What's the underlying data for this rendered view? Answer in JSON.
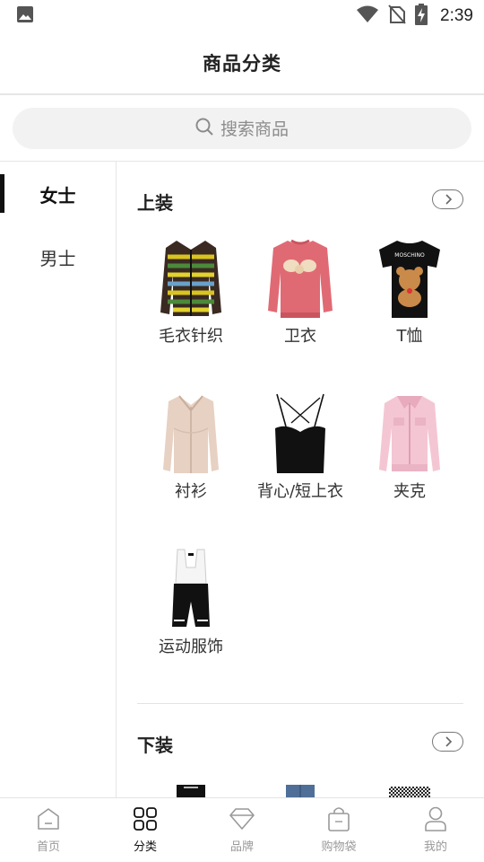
{
  "status_bar": {
    "time": "2:39"
  },
  "header": {
    "title": "商品分类"
  },
  "search": {
    "placeholder": "搜索商品"
  },
  "sidebar": {
    "items": [
      {
        "label": "女士",
        "active": true
      },
      {
        "label": "男士",
        "active": false
      }
    ]
  },
  "sections": [
    {
      "title": "上装",
      "items": [
        {
          "label": "毛衣针织",
          "icon": "cardigan-image"
        },
        {
          "label": "卫衣",
          "icon": "sweatshirt-image"
        },
        {
          "label": "T恤",
          "icon": "tshirt-image"
        },
        {
          "label": "衬衫",
          "icon": "shirt-image"
        },
        {
          "label": "背心/短上衣",
          "icon": "camisole-image"
        },
        {
          "label": "夹克",
          "icon": "jacket-image"
        },
        {
          "label": "运动服饰",
          "icon": "cycling-suit-image"
        }
      ]
    },
    {
      "title": "下装",
      "items": [
        {
          "label": "",
          "icon": "skirt-image"
        },
        {
          "label": "",
          "icon": "jeans-image"
        },
        {
          "label": "",
          "icon": "tweed-skirt-image"
        }
      ]
    }
  ],
  "bottom_nav": {
    "items": [
      {
        "label": "首页",
        "icon": "home-icon",
        "active": false
      },
      {
        "label": "分类",
        "icon": "category-icon",
        "active": true
      },
      {
        "label": "品牌",
        "icon": "diamond-icon",
        "active": false
      },
      {
        "label": "购物袋",
        "icon": "shopping-bag-icon",
        "active": false
      },
      {
        "label": "我的",
        "icon": "profile-icon",
        "active": false
      }
    ]
  }
}
